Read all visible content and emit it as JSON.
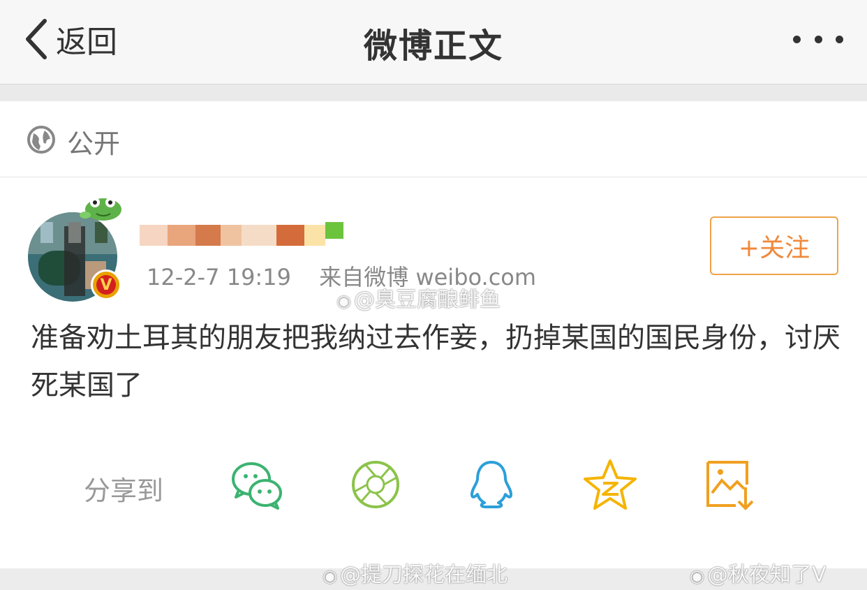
{
  "nav": {
    "back_label": "返回",
    "title": "微博正文"
  },
  "visibility": {
    "label": "公开"
  },
  "post": {
    "timestamp": "12-2-7 19:19",
    "source": "来自微博 weibo.com",
    "follow_label": "+关注",
    "text": "准备劝土耳其的朋友把我纳过去作妾，扔掉某国的国民身份，讨厌死某国了"
  },
  "share": {
    "label": "分享到",
    "targets": [
      "wechat-icon",
      "moments-icon",
      "qq-icon",
      "qzone-icon",
      "save-image-icon"
    ],
    "colors": {
      "wechat": "#3cb371",
      "moments": "#8bc34a",
      "qq": "#2c9fd9",
      "qzone": "#f5b400",
      "save": "#f0a020"
    }
  },
  "watermarks": {
    "wm1": "@臭豆腐酿鲱鱼",
    "wm2": "@提刀探花在缅北",
    "wm3": "@秋夜知了V"
  },
  "colors": {
    "accent_orange": "#f0883a",
    "verified_badge": "#e8a100"
  }
}
